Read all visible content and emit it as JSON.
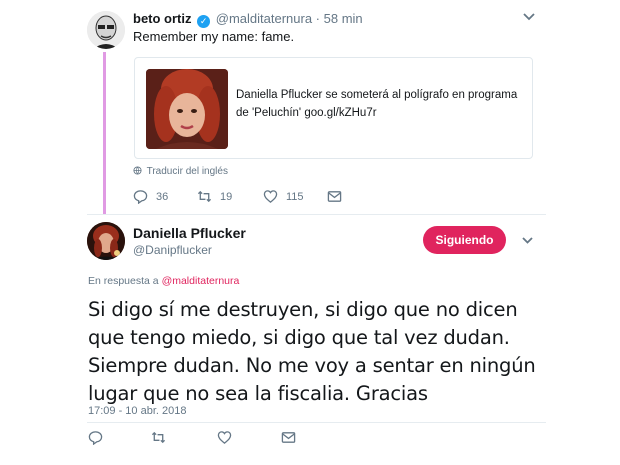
{
  "tweet1": {
    "name": "beto ortiz",
    "handle": "@malditaternura",
    "separator": "·",
    "time": "58 min",
    "text": "Remember my name: fame.",
    "card": {
      "text": "Daniella Pflucker se someterá al polígrafo en programa de 'Peluchín' goo.gl/kZHu7r"
    },
    "translate": "Traducir del inglés",
    "actions": {
      "reply_count": "36",
      "retweet_count": "19",
      "like_count": "115"
    }
  },
  "tweet2": {
    "name": "Daniella Pflucker",
    "handle": "@Danipflucker",
    "follow_label": "Siguiendo",
    "reply_prefix": "En respuesta a",
    "reply_to": "@malditaternura",
    "text": "Si digo sí me destruyen, si digo que no dicen que tengo miedo, si digo que tal vez dudan. Siempre dudan. No me voy a sentar en ningún lugar que no sea la fiscalia. Gracias",
    "timestamp": "17:09 - 10 abr. 2018"
  },
  "colors": {
    "accent": "#e0245e",
    "verified": "#1da1f2",
    "thread_line": "#e09ae3",
    "muted": "#657786"
  },
  "icons": [
    "verified-badge-icon",
    "chevron-down-icon",
    "globe-icon",
    "reply-icon",
    "retweet-icon",
    "like-icon",
    "direct-message-icon"
  ]
}
